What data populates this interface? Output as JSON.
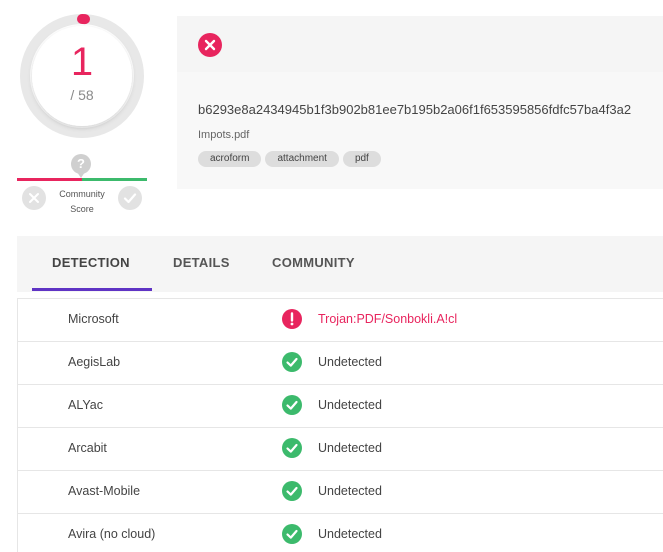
{
  "score": {
    "detections": "1",
    "total": "/ 58",
    "detection_fraction": 0.01724,
    "colors": {
      "accent": "#e8255e",
      "ring": "#e8e8e8"
    }
  },
  "community": {
    "question": "?",
    "label": "Community\nScore",
    "bad_icon": "x-circle-icon",
    "good_icon": "check-circle-icon"
  },
  "file": {
    "status_icon": "x-circle-icon",
    "hash": "b6293e8a2434945b1f3b902b81ee7b195b2a06f1f653595856fdfc57ba4f3a2",
    "name": "Impots.pdf",
    "tags": [
      "acroform",
      "attachment",
      "pdf"
    ]
  },
  "tabs": [
    {
      "label": "DETECTION",
      "active": true
    },
    {
      "label": "DETAILS",
      "active": false
    },
    {
      "label": "COMMUNITY",
      "active": false
    }
  ],
  "detections": [
    {
      "engine": "Microsoft",
      "result": "Trojan:PDF/Sonbokli.A!cl",
      "status": "malicious",
      "icon": "exclamation-circle-icon"
    },
    {
      "engine": "AegisLab",
      "result": "Undetected",
      "status": "clean",
      "icon": "check-circle-icon"
    },
    {
      "engine": "ALYac",
      "result": "Undetected",
      "status": "clean",
      "icon": "check-circle-icon"
    },
    {
      "engine": "Arcabit",
      "result": "Undetected",
      "status": "clean",
      "icon": "check-circle-icon"
    },
    {
      "engine": "Avast-Mobile",
      "result": "Undetected",
      "status": "clean",
      "icon": "check-circle-icon"
    },
    {
      "engine": "Avira (no cloud)",
      "result": "Undetected",
      "status": "clean",
      "icon": "check-circle-icon"
    }
  ],
  "colors": {
    "malicious": "#e8255e",
    "clean": "#3cba6c",
    "tab_underline": "#5f33c4"
  }
}
